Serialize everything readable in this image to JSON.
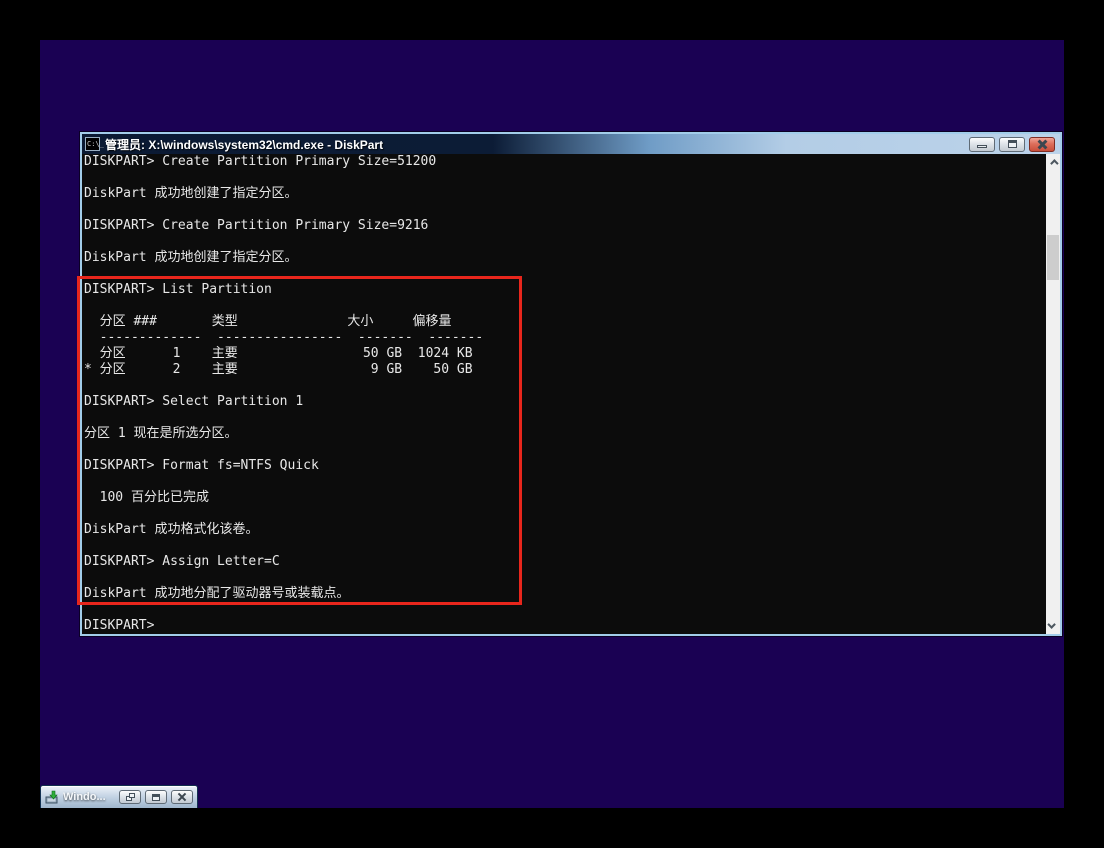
{
  "window": {
    "title": "管理员: X:\\windows\\system32\\cmd.exe - DiskPart",
    "icon": "cmd-icon",
    "icon_glyph": "C:\\_",
    "controls": {
      "minimize": "minimize",
      "maximize": "maximize",
      "close": "close"
    }
  },
  "console": {
    "lines": [
      "DISKPART> Create Partition Primary Size=51200",
      "",
      "DiskPart 成功地创建了指定分区。",
      "",
      "DISKPART> Create Partition Primary Size=9216",
      "",
      "DiskPart 成功地创建了指定分区。",
      "",
      "DISKPART> List Partition",
      "",
      "  分区 ###       类型              大小     偏移量",
      "  -------------  ----------------  -------  -------",
      "  分区      1    主要                50 GB  1024 KB",
      "* 分区      2    主要                 9 GB    50 GB",
      "",
      "DISKPART> Select Partition 1",
      "",
      "分区 1 现在是所选分区。",
      "",
      "DISKPART> Format fs=NTFS Quick",
      "",
      "  100 百分比已完成",
      "",
      "DiskPart 成功格式化该卷。",
      "",
      "DISKPART> Assign Letter=C",
      "",
      "DiskPart 成功地分配了驱动器号或装载点。",
      "",
      "DISKPART>"
    ],
    "partition_table": {
      "type": "table",
      "columns": [
        "分区 ###",
        "类型",
        "大小",
        "偏移量"
      ],
      "rows": [
        {
          "selected": false,
          "partition": "分区 1",
          "type": "主要",
          "size": "50 GB",
          "offset": "1024 KB"
        },
        {
          "selected": true,
          "partition": "分区 2",
          "type": "主要",
          "size": "9 GB",
          "offset": "50 GB"
        }
      ]
    }
  },
  "annotation": {
    "shape": "rectangle",
    "color": "#e8261c"
  },
  "taskbar": {
    "item": {
      "label": "Windo...",
      "icon": "windows-setup-icon",
      "controls": [
        "restore",
        "maximize",
        "close"
      ]
    }
  },
  "colors": {
    "desktop": "#1a0153",
    "outer_frame": "#000000",
    "console_bg": "#0c0c0c",
    "console_text": "#e8e8e8",
    "titlebar_left": "#0b1a33",
    "titlebar_right": "#bcd3ea",
    "window_border": "#a2cdea",
    "annotation_red": "#e8261c",
    "scrollbar_track": "#f0f0f0",
    "scrollbar_thumb": "#cdcdcd"
  }
}
